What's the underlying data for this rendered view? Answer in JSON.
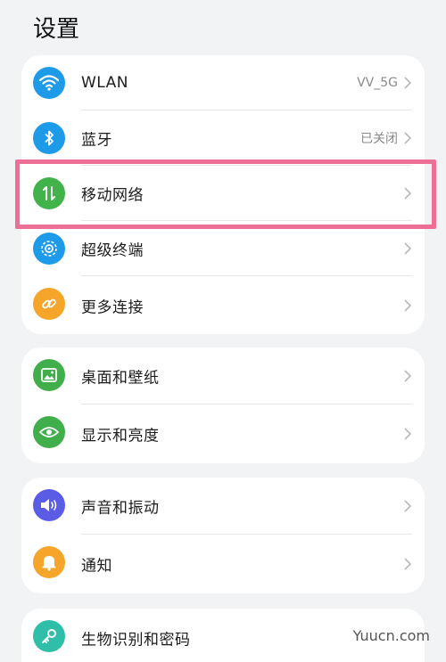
{
  "header": {
    "title": "设置"
  },
  "groups": [
    {
      "items": [
        {
          "label": "WLAN",
          "value": "VV_5G",
          "icon": "wifi-icon",
          "color": "#1e9be8"
        },
        {
          "label": "蓝牙",
          "value": "已关闭",
          "icon": "bluetooth-icon",
          "color": "#1e9be8"
        },
        {
          "label": "移动网络",
          "value": "",
          "icon": "mobile-data-icon",
          "color": "#42b34a"
        },
        {
          "label": "超级终端",
          "value": "",
          "icon": "super-device-icon",
          "color": "#1e9be8"
        },
        {
          "label": "更多连接",
          "value": "",
          "icon": "link-icon",
          "color": "#f4a52a"
        }
      ]
    },
    {
      "items": [
        {
          "label": "桌面和壁纸",
          "value": "",
          "icon": "wallpaper-icon",
          "color": "#3fae4b"
        },
        {
          "label": "显示和亮度",
          "value": "",
          "icon": "eye-icon",
          "color": "#3fae4b"
        }
      ]
    },
    {
      "items": [
        {
          "label": "声音和振动",
          "value": "",
          "icon": "sound-icon",
          "color": "#5b5ce6"
        },
        {
          "label": "通知",
          "value": "",
          "icon": "bell-icon",
          "color": "#f4a52a"
        }
      ]
    },
    {
      "items": [
        {
          "label": "生物识别和密码",
          "value": "",
          "icon": "key-icon",
          "color": "#2fbfa8"
        }
      ]
    }
  ],
  "highlight_color": "#ee6f96",
  "watermark": "Yuucn.com"
}
